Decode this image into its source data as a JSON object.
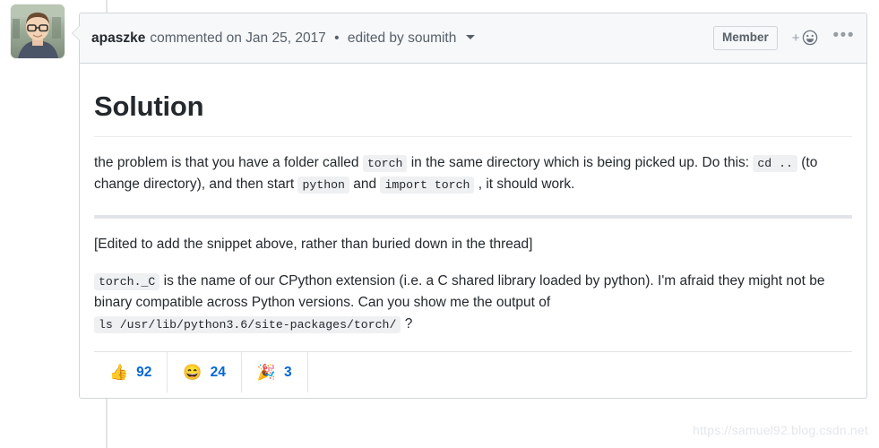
{
  "avatar": {
    "alt": "apaszke-avatar"
  },
  "header": {
    "author": "apaszke",
    "action": "commented on",
    "date": "Jan 25, 2017",
    "separator": "•",
    "edited_by": "edited by soumith",
    "member_badge": "Member",
    "add_reaction_plus": "+",
    "add_reaction_icon": "smiley-icon",
    "kebab_icon": "•••"
  },
  "body": {
    "heading": "Solution",
    "p1": {
      "t1": "the problem is that you have a folder called ",
      "c1": "torch",
      "t2": " in the same directory which is being picked up. Do this: ",
      "c2": "cd ..",
      "t3": " (to change directory), and then start ",
      "c3": "python",
      "t4": " and ",
      "c4": "import torch",
      "t5": " , it should work."
    },
    "p2": "[Edited to add the snippet above, rather than buried down in the thread]",
    "p3": {
      "c1": "torch._C",
      "t1": " is the name of our CPython extension (i.e. a C shared library loaded by python). I'm afraid they might not be binary compatible across Python versions. Can you show me the output of ",
      "c2": "ls /usr/lib/python3.6/site-packages/torch/",
      "t2": " ?"
    }
  },
  "reactions": [
    {
      "name": "thumbs-up",
      "emoji": "👍",
      "count": "92"
    },
    {
      "name": "laugh",
      "emoji": "😄",
      "count": "24"
    },
    {
      "name": "hooray",
      "emoji": "🎉",
      "count": "3"
    }
  ],
  "watermark": "https://samuel92.blog.csdn.net",
  "colors": {
    "link": "#0366d6",
    "muted": "#586069",
    "border": "#d1d5da",
    "header_bg": "#f6f8fa"
  }
}
